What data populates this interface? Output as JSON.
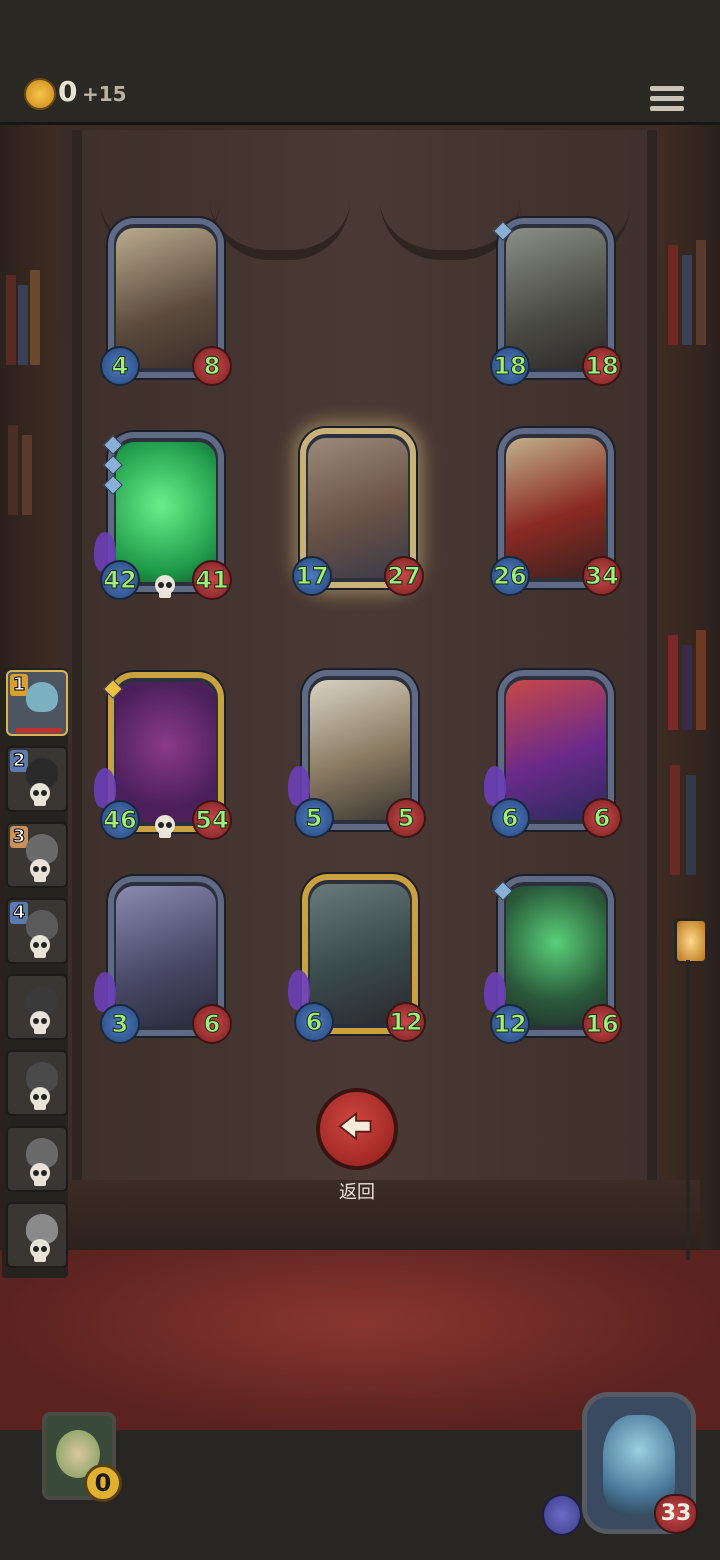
{
  "header": {
    "coins": "0",
    "coin_increment": "+15"
  },
  "board": {
    "cards": [
      {
        "atk": "4",
        "hp": "8"
      },
      {
        "atk": "18",
        "hp": "18"
      },
      {
        "atk": "42",
        "hp": "41"
      },
      {
        "atk": "17",
        "hp": "27"
      },
      {
        "atk": "26",
        "hp": "34"
      },
      {
        "atk": "46",
        "hp": "54"
      },
      {
        "atk": "5",
        "hp": "5"
      },
      {
        "atk": "6",
        "hp": "6"
      },
      {
        "atk": "3",
        "hp": "6"
      },
      {
        "atk": "6",
        "hp": "12"
      },
      {
        "atk": "12",
        "hp": "16"
      }
    ]
  },
  "queue": {
    "ranks": [
      "1",
      "2",
      "3",
      "4"
    ]
  },
  "back_button": {
    "label": "返回"
  },
  "player": {
    "gold": "0",
    "health": "33"
  },
  "colors": {
    "stat_text": "#9ef07a",
    "attack_orb": "#3f65a3",
    "health_orb": "#a33333",
    "back_button": "#b3322d",
    "gold_frame": "#c9a13e"
  }
}
